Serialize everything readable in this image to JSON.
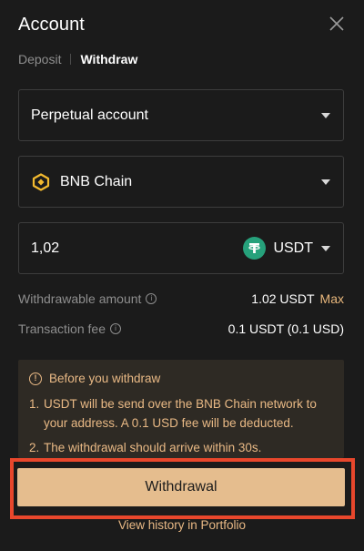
{
  "header": {
    "title": "Account"
  },
  "tabs": [
    {
      "label": "Deposit",
      "active": false
    },
    {
      "label": "Withdraw",
      "active": true
    }
  ],
  "account_select": {
    "value": "Perpetual account"
  },
  "network_select": {
    "value": "BNB Chain",
    "icon": "bnb-chain-icon"
  },
  "amount": {
    "value": "1,02",
    "asset": "USDT",
    "asset_icon": "tether-icon"
  },
  "withdrawable": {
    "label": "Withdrawable amount",
    "value": "1.02 USDT",
    "max_label": "Max"
  },
  "fee": {
    "label": "Transaction fee",
    "value": "0.1 USDT (0.1 USD)"
  },
  "notice": {
    "title": "Before you withdraw",
    "items": [
      {
        "num": "1.",
        "text": "USDT will be send over the BNB Chain network to your address. A 0.1 USD fee will be deducted."
      },
      {
        "num": "2.",
        "text": "The withdrawal should arrive within 30s."
      }
    ]
  },
  "withdraw_button": {
    "label": "Withdrawal"
  },
  "history_link": {
    "label": "View history in Portfolio"
  },
  "colors": {
    "background": "#1b1b1b",
    "accent": "#e5bd8e",
    "notice_bg": "#2e2a24",
    "notice_text": "#e9b985",
    "highlight": "#e8472c",
    "tether": "#26a17b",
    "bnb": "#f3ba2f"
  }
}
